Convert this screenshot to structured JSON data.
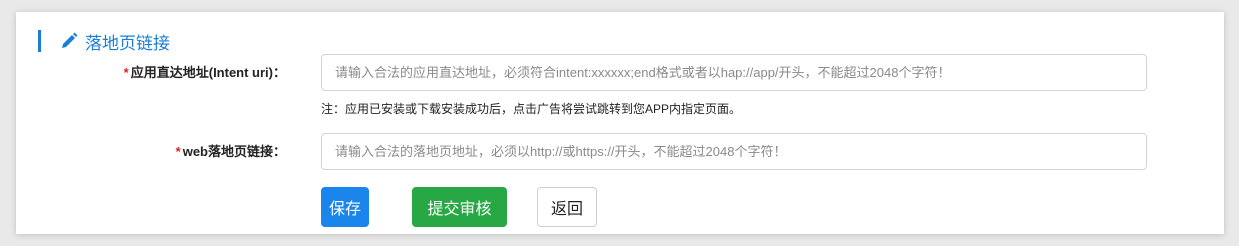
{
  "section": {
    "title": "落地页链接",
    "icon": "pencil-icon",
    "accent_color": "#1a7ed6"
  },
  "form": {
    "intent_uri": {
      "required_mark": "*",
      "label": "应用直达地址(Intent uri)：",
      "value": "",
      "placeholder": "请输入合法的应用直达地址，必须符合intent:xxxxxx;end格式或者以hap://app/开头，不能超过2048个字符！",
      "note": "注：应用已安装或下载安装成功后，点击广告将尝试跳转到您APP内指定页面。"
    },
    "web_link": {
      "required_mark": "*",
      "label": "web落地页链接：",
      "value": "",
      "placeholder": "请输入合法的落地页地址，必须以http://或https://开头，不能超过2048个字符！"
    }
  },
  "buttons": {
    "save_label": "保存",
    "submit_label": "提交审核",
    "back_label": "返回",
    "save_color": "#1a85ea",
    "submit_color": "#28a745"
  }
}
